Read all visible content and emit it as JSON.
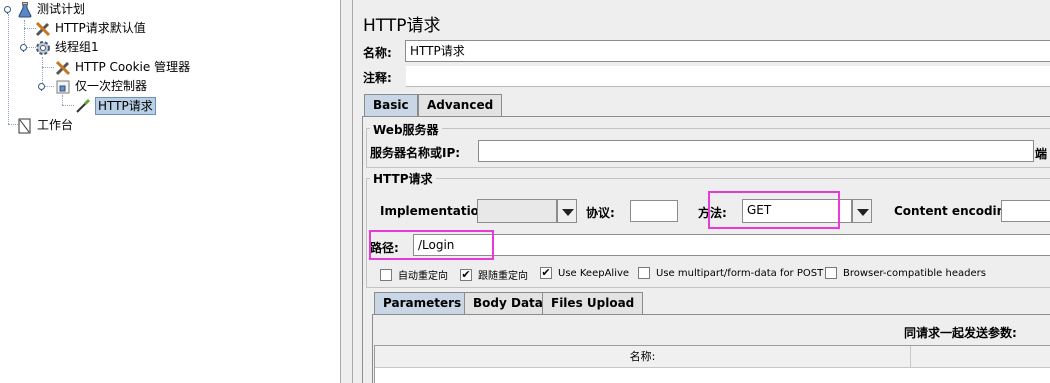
{
  "tree": {
    "items": [
      {
        "label": "测试计划",
        "icon": "flask-icon"
      },
      {
        "label": "HTTP请求默认值",
        "icon": "wrench-icon"
      },
      {
        "label": "线程组1",
        "icon": "gear-icon"
      },
      {
        "label": "HTTP Cookie 管理器",
        "icon": "wrench-icon"
      },
      {
        "label": "仅一次控制器",
        "icon": "controller-icon"
      },
      {
        "label": "HTTP请求",
        "icon": "pipette-icon"
      },
      {
        "label": "工作台",
        "icon": "workbench-icon"
      }
    ]
  },
  "panel": {
    "title": "HTTP请求",
    "name_label": "名称:",
    "name_value": "HTTP请求",
    "comment_label": "注释:",
    "tabs": [
      "Basic",
      "Advanced"
    ],
    "web_server_group": "Web服务器",
    "server_label": "服务器名称或IP:",
    "port_label_fragment": "端",
    "http_group": "HTTP请求",
    "impl_label": "Implementation:",
    "protocol_label": "协议:",
    "method_label": "方法:",
    "method_value": "GET",
    "encoding_label": "Content encoding:",
    "path_label": "路径:",
    "path_value": "/Login",
    "checkboxes": [
      {
        "label": "自动重定向",
        "checked": false
      },
      {
        "label": "跟随重定向",
        "checked": true
      },
      {
        "label": "Use KeepAlive",
        "checked": true
      },
      {
        "label": "Use multipart/form-data for POST",
        "checked": false
      },
      {
        "label": "Browser-compatible headers",
        "checked": false
      }
    ],
    "sub_tabs": [
      "Parameters",
      "Body Data",
      "Files Upload"
    ],
    "send_params_label": "同请求一起发送参数:",
    "col_name": "名称:",
    "highlight_color": "#e83ad8"
  }
}
